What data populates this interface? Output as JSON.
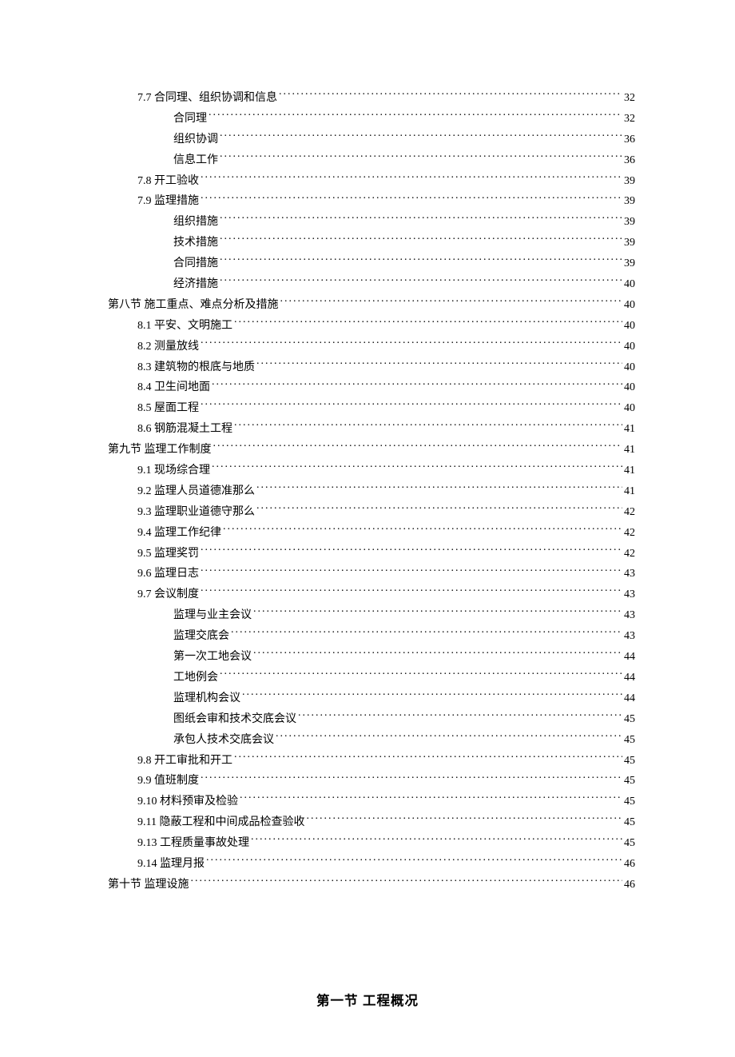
{
  "toc": [
    {
      "indent": 1,
      "label": "7.7  合同理、组织协调和信息",
      "page": "32"
    },
    {
      "indent": 2,
      "label": "合同理",
      "page": "32"
    },
    {
      "indent": 2,
      "label": "组织协调",
      "page": "36"
    },
    {
      "indent": 2,
      "label": "信息工作",
      "page": "36"
    },
    {
      "indent": 1,
      "label": "7.8  开工验收",
      "page": "39"
    },
    {
      "indent": 1,
      "label": "7.9  监理措施",
      "page": "39"
    },
    {
      "indent": 2,
      "label": "组织措施",
      "page": "39"
    },
    {
      "indent": 2,
      "label": "技术措施",
      "page": "39"
    },
    {
      "indent": 2,
      "label": "合同措施",
      "page": "39"
    },
    {
      "indent": 2,
      "label": "经济措施",
      "page": "40"
    },
    {
      "indent": 0,
      "label": "第八节  施工重点、难点分析及措施",
      "page": "40"
    },
    {
      "indent": 1,
      "label": "8.1  平安、文明施工",
      "page": "40"
    },
    {
      "indent": 1,
      "label": "8.2 测量放线",
      "page": "40"
    },
    {
      "indent": 1,
      "label": "8.3  建筑物的根底与地质",
      "page": "40"
    },
    {
      "indent": 1,
      "label": "8.4  卫生间地面",
      "page": "40"
    },
    {
      "indent": 1,
      "label": "8.5  屋面工程",
      "page": "40"
    },
    {
      "indent": 1,
      "label": "8.6  钢筋混凝土工程",
      "page": "41"
    },
    {
      "indent": 0,
      "label": "第九节  监理工作制度",
      "page": "41"
    },
    {
      "indent": 1,
      "label": "9.1  现场综合理",
      "page": "41"
    },
    {
      "indent": 1,
      "label": "9.2  监理人员道德准那么 ",
      "page": "41"
    },
    {
      "indent": 1,
      "label": "9.3  监理职业道德守那么 ",
      "page": "42"
    },
    {
      "indent": 1,
      "label": "9.4  监理工作纪律",
      "page": "42"
    },
    {
      "indent": 1,
      "label": "9.5  监理奖罚",
      "page": "42"
    },
    {
      "indent": 1,
      "label": "9.6  监理日志",
      "page": "43"
    },
    {
      "indent": 1,
      "label": "9.7  会议制度",
      "page": "43"
    },
    {
      "indent": 2,
      "label": "监理与业主会议",
      "page": "43"
    },
    {
      "indent": 2,
      "label": "监理交底会",
      "page": "43"
    },
    {
      "indent": 2,
      "label": "第一次工地会议",
      "page": "44"
    },
    {
      "indent": 2,
      "label": "工地例会",
      "page": "44"
    },
    {
      "indent": 2,
      "label": "监理机构会议",
      "page": "44"
    },
    {
      "indent": 2,
      "label": "图纸会审和技术交底会议",
      "page": "45"
    },
    {
      "indent": 2,
      "label": "承包人技术交底会议",
      "page": "45"
    },
    {
      "indent": 1,
      "label": "9.8  开工审批和开工",
      "page": "45"
    },
    {
      "indent": 1,
      "label": "9.9 值班制度",
      "page": "45"
    },
    {
      "indent": 1,
      "label": "9.10 材料预审及检验",
      "page": "45"
    },
    {
      "indent": 1,
      "label": "9.11 隐蔽工程和中间成品检查验收",
      "page": "45"
    },
    {
      "indent": 1,
      "label": "9.13  工程质量事故处理",
      "page": "45"
    },
    {
      "indent": 1,
      "label": "9.14  监理月报",
      "page": "46"
    },
    {
      "indent": 0,
      "label": "第十节  监理设施",
      "page": "46"
    }
  ],
  "sectionTitle": "第一节 工程概况"
}
